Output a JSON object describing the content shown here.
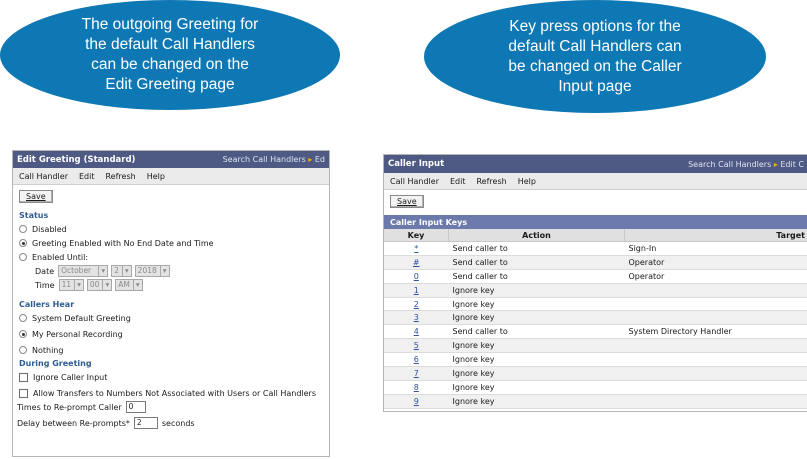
{
  "callout_left": [
    "The outgoing Greeting for",
    "the default Call Handlers",
    "can be changed on the",
    "Edit Greeting page"
  ],
  "callout_right": [
    "Key press options for the",
    "default Call Handlers can",
    "be changed on the Caller",
    "Input page"
  ],
  "colors": {
    "callout": "#0e78b4",
    "titlebar": "#4e5a84",
    "section": "#2e5c94",
    "link": "#3050a0"
  },
  "greeting": {
    "title": "Edit Greeting  (Standard)",
    "nav": "Search Call Handlers",
    "nav_tail": "Ed",
    "menu": [
      "Call Handler",
      "Edit",
      "Refresh",
      "Help"
    ],
    "save_label": "Save",
    "status": {
      "heading": "Status",
      "options": [
        "Disabled",
        "Greeting Enabled with No End Date and Time",
        "Enabled Until:"
      ],
      "selected_index": 1,
      "date_label": "Date",
      "date_values": [
        "October",
        "2",
        "2018"
      ],
      "time_label": "Time",
      "time_values": [
        "11",
        "00",
        "AM"
      ]
    },
    "callers_hear": {
      "heading": "Callers Hear",
      "options": [
        "System Default Greeting",
        "My Personal Recording",
        "Nothing"
      ],
      "selected_index": 1
    },
    "during": {
      "heading": "During Greeting",
      "checkboxes": [
        "Ignore Caller Input",
        "Allow Transfers to Numbers Not Associated with Users or Call Handlers"
      ],
      "reprompt_label": "Times to Re-prompt Caller",
      "reprompt_value": "0",
      "delay_label": "Delay between Re-prompts*",
      "delay_value": "2",
      "delay_unit": "seconds"
    }
  },
  "caller_input": {
    "title": "Caller Input",
    "nav": "Search Call Handlers",
    "nav_tail": "Edit C",
    "menu": [
      "Call Handler",
      "Edit",
      "Refresh",
      "Help"
    ],
    "save_label": "Save",
    "keys_title": "Caller Input Keys",
    "columns": [
      "Key",
      "Action",
      "Target"
    ],
    "rows": [
      {
        "key": "*",
        "action": "Send caller to",
        "target": "Sign-In"
      },
      {
        "key": "#",
        "action": "Send caller to",
        "target": "Operator"
      },
      {
        "key": "0",
        "action": "Send caller to",
        "target": "Operator"
      },
      {
        "key": "1",
        "action": "Ignore key",
        "target": ""
      },
      {
        "key": "2",
        "action": "Ignore key",
        "target": ""
      },
      {
        "key": "3",
        "action": "Ignore key",
        "target": ""
      },
      {
        "key": "4",
        "action": "Send caller to",
        "target": "System Directory Handler"
      },
      {
        "key": "5",
        "action": "Ignore key",
        "target": ""
      },
      {
        "key": "6",
        "action": "Ignore key",
        "target": ""
      },
      {
        "key": "7",
        "action": "Ignore key",
        "target": ""
      },
      {
        "key": "8",
        "action": "Ignore key",
        "target": ""
      },
      {
        "key": "9",
        "action": "Ignore key",
        "target": ""
      }
    ]
  }
}
